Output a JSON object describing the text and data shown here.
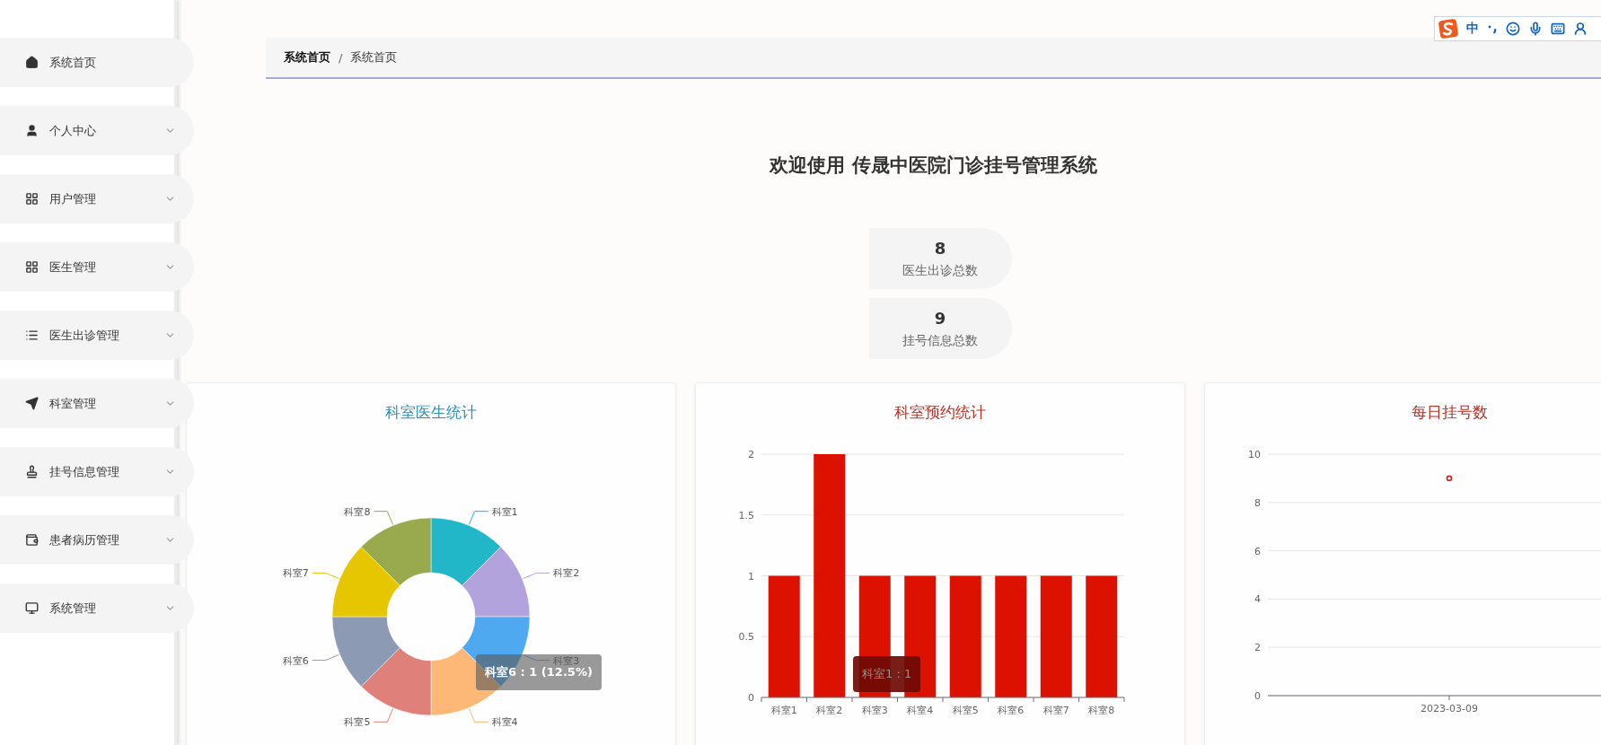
{
  "ime_toolbar": {
    "mode": "中"
  },
  "sidebar": {
    "items": [
      {
        "label": "系统首页",
        "has_submenu": false
      },
      {
        "label": "个人中心",
        "has_submenu": true
      },
      {
        "label": "用户管理",
        "has_submenu": true
      },
      {
        "label": "医生管理",
        "has_submenu": true
      },
      {
        "label": "医生出诊管理",
        "has_submenu": true
      },
      {
        "label": "科室管理",
        "has_submenu": true
      },
      {
        "label": "挂号信息管理",
        "has_submenu": true
      },
      {
        "label": "患者病历管理",
        "has_submenu": true
      },
      {
        "label": "系统管理",
        "has_submenu": true
      }
    ]
  },
  "breadcrumb": {
    "separator": "/",
    "items": [
      {
        "label": "系统首页",
        "bold": true
      },
      {
        "label": "系统首页",
        "bold": false
      }
    ]
  },
  "welcome": {
    "title": "欢迎使用 传晟中医院门诊挂号管理系统"
  },
  "stats": [
    {
      "value": "8",
      "label": "医生出诊总数"
    },
    {
      "value": "9",
      "label": "挂号信息总数"
    }
  ],
  "charts": [
    {
      "title": "科室医生统计",
      "color": "#2a8fb8",
      "tooltip": "科室6 : 1 (12.5%)",
      "chart_data": {
        "type": "donut",
        "categories": [
          "科室1",
          "科室2",
          "科室3",
          "科室4",
          "科室5",
          "科室6",
          "科室7",
          "科室8"
        ],
        "series": [
          {
            "values": [
              1,
              1,
              1,
              1,
              1,
              1,
              1,
              1
            ]
          }
        ],
        "colors": [
          "#22b6c9",
          "#b3a3dc",
          "#4fa9f0",
          "#fdb878",
          "#e0807a",
          "#8c9ab4",
          "#e5c600",
          "#98a94e"
        ]
      }
    },
    {
      "title": "科室预约统计",
      "color": "#b43228",
      "tooltip": "科室1 : 1",
      "chart_data": {
        "type": "bar",
        "categories": [
          "科室1",
          "科室2",
          "科室3",
          "科室4",
          "科室5",
          "科室6",
          "科室7",
          "科室8"
        ],
        "series": [
          {
            "color": "#dd1100",
            "values": [
              1,
              2,
              1,
              1,
              1,
              1,
              1,
              1
            ]
          }
        ],
        "grid": true,
        "ylim": [
          0,
          2
        ],
        "yticks": [
          0,
          0.5,
          1,
          1.5,
          2
        ]
      }
    },
    {
      "title": "每日挂号数",
      "color": "#b43228",
      "chart_data": {
        "type": "line",
        "categories": [
          "2023-03-09"
        ],
        "series": [
          {
            "color": "#c0281e",
            "marker": true,
            "values": [
              9
            ]
          }
        ],
        "grid": true,
        "ylim": [
          0,
          10
        ],
        "yticks": [
          0,
          2,
          4,
          6,
          8,
          10
        ]
      }
    }
  ]
}
